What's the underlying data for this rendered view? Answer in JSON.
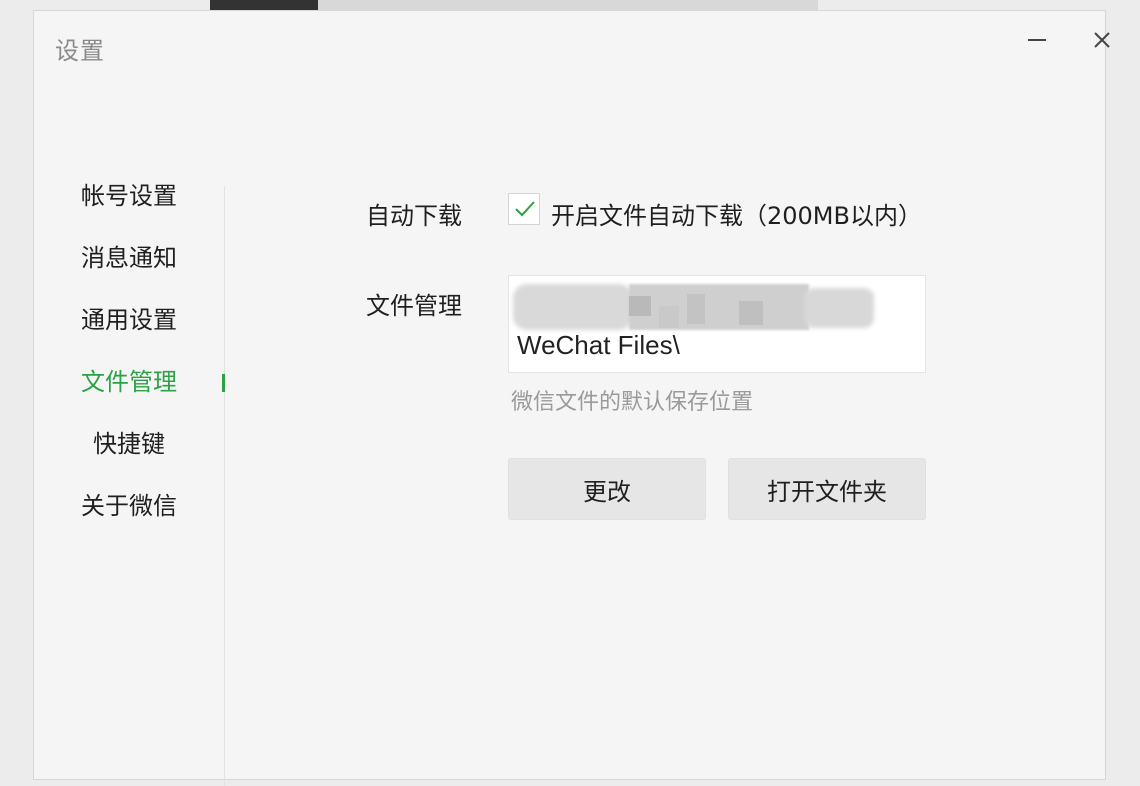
{
  "dialog": {
    "title": "设置"
  },
  "sidebar": {
    "items": [
      {
        "label": "帐号设置"
      },
      {
        "label": "消息通知"
      },
      {
        "label": "通用设置"
      },
      {
        "label": "文件管理"
      },
      {
        "label": "快捷键"
      },
      {
        "label": "关于微信"
      }
    ],
    "active_index": 3
  },
  "file_settings": {
    "auto_download_label": "自动下载",
    "auto_download_checked": true,
    "auto_download_text": "开启文件自动下载（200MB以内）",
    "file_manage_label": "文件管理",
    "path_visible_text": "WeChat Files\\",
    "path_hint": "微信文件的默认保存位置",
    "change_button": "更改",
    "open_folder_button": "打开文件夹"
  },
  "colors": {
    "accent": "#2ba245",
    "dialog_bg": "#f5f5f5",
    "button_bg": "#e6e6e6"
  },
  "icons": {
    "minimize": "minimize-icon",
    "close": "close-icon",
    "check": "check-icon"
  }
}
